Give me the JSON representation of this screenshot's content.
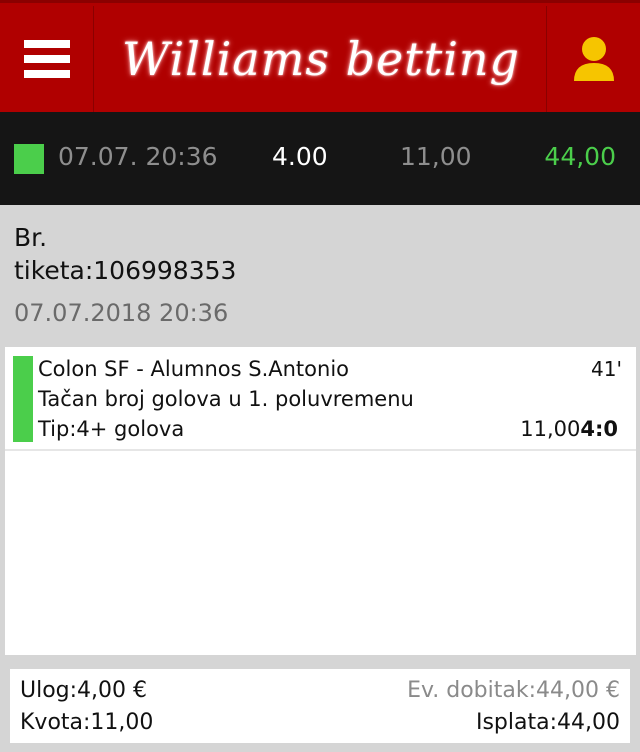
{
  "header": {
    "logo_text": "Williams betting",
    "menu_icon": "hamburger-menu-icon",
    "user_icon": "user-icon",
    "user_icon_color": "#f6c500",
    "brand_color": "#b00000"
  },
  "summary": {
    "status_color": "#4bce4b",
    "date": "07.07. 20:36",
    "stake": "4.00",
    "odds": "11,00",
    "win": "44,00"
  },
  "ticket": {
    "label": "Br.",
    "number": "tiketa:106998353",
    "datetime": "07.07.2018 20:36"
  },
  "bets": [
    {
      "match": "Colon SF - Alumnos S.Antonio",
      "minute": "41'",
      "market": "Tačan broj golova u 1. poluvremenu",
      "tip": "Tip:4+ golova",
      "odds": "11,00",
      "score": "4:0",
      "status_color": "#4bce4b"
    }
  ],
  "footer": {
    "stake": "Ulog:4,00 €",
    "odds": "Kvota:11,00",
    "potential_win": "Ev. dobitak:44,00 €",
    "payout": "Isplata:44,00"
  }
}
